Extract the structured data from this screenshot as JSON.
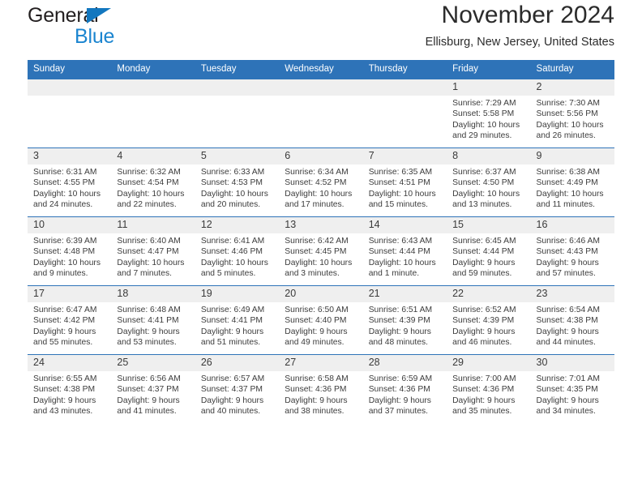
{
  "brand": {
    "name_part1": "General",
    "name_part2": "Blue",
    "accent_color": "#1b85d0",
    "triangle_color": "#1277bf"
  },
  "header": {
    "title": "November 2024",
    "subtitle": "Ellisburg, New Jersey, United States",
    "header_bg": "#2e73b8",
    "daynum_bg": "#efefef"
  },
  "calendar": {
    "columns": [
      "Sunday",
      "Monday",
      "Tuesday",
      "Wednesday",
      "Thursday",
      "Friday",
      "Saturday"
    ],
    "labels": {
      "sunrise": "Sunrise:",
      "sunset": "Sunset:",
      "daylight": "Daylight:"
    },
    "weeks": [
      [
        {
          "day": "",
          "blank": true
        },
        {
          "day": "",
          "blank": true
        },
        {
          "day": "",
          "blank": true
        },
        {
          "day": "",
          "blank": true
        },
        {
          "day": "",
          "blank": true
        },
        {
          "day": "1",
          "sunrise": "Sunrise: 7:29 AM",
          "sunset": "Sunset: 5:58 PM",
          "daylight": "Daylight: 10 hours and 29 minutes."
        },
        {
          "day": "2",
          "sunrise": "Sunrise: 7:30 AM",
          "sunset": "Sunset: 5:56 PM",
          "daylight": "Daylight: 10 hours and 26 minutes."
        }
      ],
      [
        {
          "day": "3",
          "sunrise": "Sunrise: 6:31 AM",
          "sunset": "Sunset: 4:55 PM",
          "daylight": "Daylight: 10 hours and 24 minutes."
        },
        {
          "day": "4",
          "sunrise": "Sunrise: 6:32 AM",
          "sunset": "Sunset: 4:54 PM",
          "daylight": "Daylight: 10 hours and 22 minutes."
        },
        {
          "day": "5",
          "sunrise": "Sunrise: 6:33 AM",
          "sunset": "Sunset: 4:53 PM",
          "daylight": "Daylight: 10 hours and 20 minutes."
        },
        {
          "day": "6",
          "sunrise": "Sunrise: 6:34 AM",
          "sunset": "Sunset: 4:52 PM",
          "daylight": "Daylight: 10 hours and 17 minutes."
        },
        {
          "day": "7",
          "sunrise": "Sunrise: 6:35 AM",
          "sunset": "Sunset: 4:51 PM",
          "daylight": "Daylight: 10 hours and 15 minutes."
        },
        {
          "day": "8",
          "sunrise": "Sunrise: 6:37 AM",
          "sunset": "Sunset: 4:50 PM",
          "daylight": "Daylight: 10 hours and 13 minutes."
        },
        {
          "day": "9",
          "sunrise": "Sunrise: 6:38 AM",
          "sunset": "Sunset: 4:49 PM",
          "daylight": "Daylight: 10 hours and 11 minutes."
        }
      ],
      [
        {
          "day": "10",
          "sunrise": "Sunrise: 6:39 AM",
          "sunset": "Sunset: 4:48 PM",
          "daylight": "Daylight: 10 hours and 9 minutes."
        },
        {
          "day": "11",
          "sunrise": "Sunrise: 6:40 AM",
          "sunset": "Sunset: 4:47 PM",
          "daylight": "Daylight: 10 hours and 7 minutes."
        },
        {
          "day": "12",
          "sunrise": "Sunrise: 6:41 AM",
          "sunset": "Sunset: 4:46 PM",
          "daylight": "Daylight: 10 hours and 5 minutes."
        },
        {
          "day": "13",
          "sunrise": "Sunrise: 6:42 AM",
          "sunset": "Sunset: 4:45 PM",
          "daylight": "Daylight: 10 hours and 3 minutes."
        },
        {
          "day": "14",
          "sunrise": "Sunrise: 6:43 AM",
          "sunset": "Sunset: 4:44 PM",
          "daylight": "Daylight: 10 hours and 1 minute."
        },
        {
          "day": "15",
          "sunrise": "Sunrise: 6:45 AM",
          "sunset": "Sunset: 4:44 PM",
          "daylight": "Daylight: 9 hours and 59 minutes."
        },
        {
          "day": "16",
          "sunrise": "Sunrise: 6:46 AM",
          "sunset": "Sunset: 4:43 PM",
          "daylight": "Daylight: 9 hours and 57 minutes."
        }
      ],
      [
        {
          "day": "17",
          "sunrise": "Sunrise: 6:47 AM",
          "sunset": "Sunset: 4:42 PM",
          "daylight": "Daylight: 9 hours and 55 minutes."
        },
        {
          "day": "18",
          "sunrise": "Sunrise: 6:48 AM",
          "sunset": "Sunset: 4:41 PM",
          "daylight": "Daylight: 9 hours and 53 minutes."
        },
        {
          "day": "19",
          "sunrise": "Sunrise: 6:49 AM",
          "sunset": "Sunset: 4:41 PM",
          "daylight": "Daylight: 9 hours and 51 minutes."
        },
        {
          "day": "20",
          "sunrise": "Sunrise: 6:50 AM",
          "sunset": "Sunset: 4:40 PM",
          "daylight": "Daylight: 9 hours and 49 minutes."
        },
        {
          "day": "21",
          "sunrise": "Sunrise: 6:51 AM",
          "sunset": "Sunset: 4:39 PM",
          "daylight": "Daylight: 9 hours and 48 minutes."
        },
        {
          "day": "22",
          "sunrise": "Sunrise: 6:52 AM",
          "sunset": "Sunset: 4:39 PM",
          "daylight": "Daylight: 9 hours and 46 minutes."
        },
        {
          "day": "23",
          "sunrise": "Sunrise: 6:54 AM",
          "sunset": "Sunset: 4:38 PM",
          "daylight": "Daylight: 9 hours and 44 minutes."
        }
      ],
      [
        {
          "day": "24",
          "sunrise": "Sunrise: 6:55 AM",
          "sunset": "Sunset: 4:38 PM",
          "daylight": "Daylight: 9 hours and 43 minutes."
        },
        {
          "day": "25",
          "sunrise": "Sunrise: 6:56 AM",
          "sunset": "Sunset: 4:37 PM",
          "daylight": "Daylight: 9 hours and 41 minutes."
        },
        {
          "day": "26",
          "sunrise": "Sunrise: 6:57 AM",
          "sunset": "Sunset: 4:37 PM",
          "daylight": "Daylight: 9 hours and 40 minutes."
        },
        {
          "day": "27",
          "sunrise": "Sunrise: 6:58 AM",
          "sunset": "Sunset: 4:36 PM",
          "daylight": "Daylight: 9 hours and 38 minutes."
        },
        {
          "day": "28",
          "sunrise": "Sunrise: 6:59 AM",
          "sunset": "Sunset: 4:36 PM",
          "daylight": "Daylight: 9 hours and 37 minutes."
        },
        {
          "day": "29",
          "sunrise": "Sunrise: 7:00 AM",
          "sunset": "Sunset: 4:36 PM",
          "daylight": "Daylight: 9 hours and 35 minutes."
        },
        {
          "day": "30",
          "sunrise": "Sunrise: 7:01 AM",
          "sunset": "Sunset: 4:35 PM",
          "daylight": "Daylight: 9 hours and 34 minutes."
        }
      ]
    ]
  }
}
